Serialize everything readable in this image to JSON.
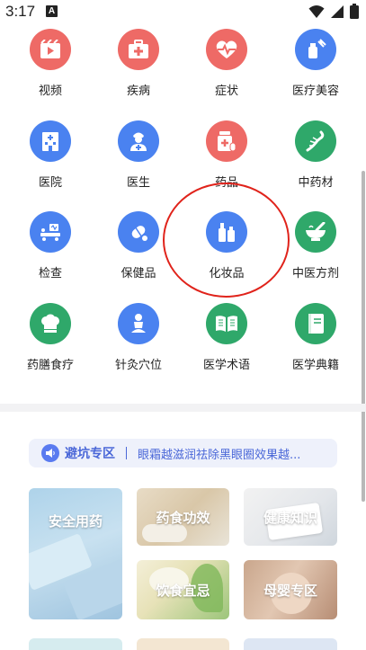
{
  "status_bar": {
    "time": "3:17",
    "notification_letter": "A"
  },
  "grid": [
    {
      "label": "视频",
      "icon": "video-icon",
      "color": "red"
    },
    {
      "label": "疾病",
      "icon": "medical-kit-icon",
      "color": "red"
    },
    {
      "label": "症状",
      "icon": "heart-pulse-icon",
      "color": "red"
    },
    {
      "label": "医疗美容",
      "icon": "beauty-bottle-icon",
      "color": "blue"
    },
    {
      "label": "医院",
      "icon": "hospital-icon",
      "color": "blue"
    },
    {
      "label": "医生",
      "icon": "doctor-icon",
      "color": "blue"
    },
    {
      "label": "药品",
      "icon": "medicine-bottle-icon",
      "color": "red"
    },
    {
      "label": "中药材",
      "icon": "herb-root-icon",
      "color": "green"
    },
    {
      "label": "检查",
      "icon": "exam-bed-icon",
      "color": "blue"
    },
    {
      "label": "保健品",
      "icon": "capsule-icon",
      "color": "blue"
    },
    {
      "label": "化妆品",
      "icon": "cosmetics-icon",
      "color": "blue"
    },
    {
      "label": "中医方剂",
      "icon": "mortar-icon",
      "color": "green"
    },
    {
      "label": "药膳食疗",
      "icon": "chef-hat-icon",
      "color": "green"
    },
    {
      "label": "针灸穴位",
      "icon": "acupuncture-icon",
      "color": "blue"
    },
    {
      "label": "医学术语",
      "icon": "open-book-icon",
      "color": "green"
    },
    {
      "label": "医学典籍",
      "icon": "closed-book-icon",
      "color": "green"
    }
  ],
  "notice": {
    "title": "避坑专区",
    "text": "眼霜越滋润祛除黑眼圈效果越..."
  },
  "cards": [
    {
      "label": "安全用药"
    },
    {
      "label": "药食功效"
    },
    {
      "label": "健康知识"
    },
    {
      "label": "饮食宜忌"
    },
    {
      "label": "母婴专区"
    }
  ],
  "colors": {
    "red": "#ee6a66",
    "blue": "#4a82f0",
    "green": "#2fa86a",
    "accent": "#4a67d8",
    "highlight": "#e0231b"
  }
}
